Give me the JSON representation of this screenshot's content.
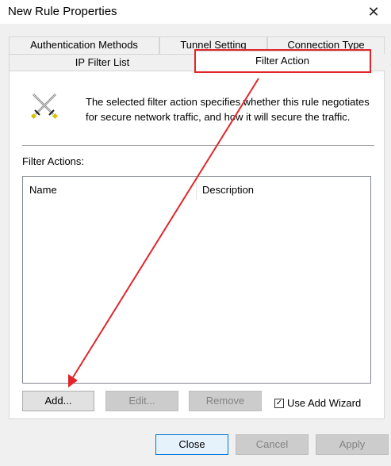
{
  "window": {
    "title": "New Rule Properties"
  },
  "tabs_back": [
    "Authentication Methods",
    "Tunnel Setting",
    "Connection Type"
  ],
  "tabs_front": [
    "IP Filter List",
    "Filter Action"
  ],
  "selected_tab": "Filter Action",
  "panel": {
    "description": "The selected filter action specifies whether this rule negotiates for secure network traffic, and how it will secure the traffic.",
    "filter_actions_label": "Filter Actions:",
    "columns": [
      "Name",
      "Description"
    ],
    "rows": []
  },
  "buttons": {
    "add": "Add...",
    "edit": "Edit...",
    "remove": "Remove"
  },
  "use_add_wizard": {
    "label": "Use Add Wizard",
    "checked": true,
    "mark": "✓"
  },
  "footer": {
    "close": "Close",
    "cancel": "Cancel",
    "apply": "Apply"
  },
  "colors": {
    "annotation": "#e0262b",
    "panel": "#ffffff",
    "window": "#f0f0f0",
    "focus": "#0078d7"
  },
  "icons": {
    "close": "close-icon",
    "swords": "crossed-swords-icon"
  }
}
